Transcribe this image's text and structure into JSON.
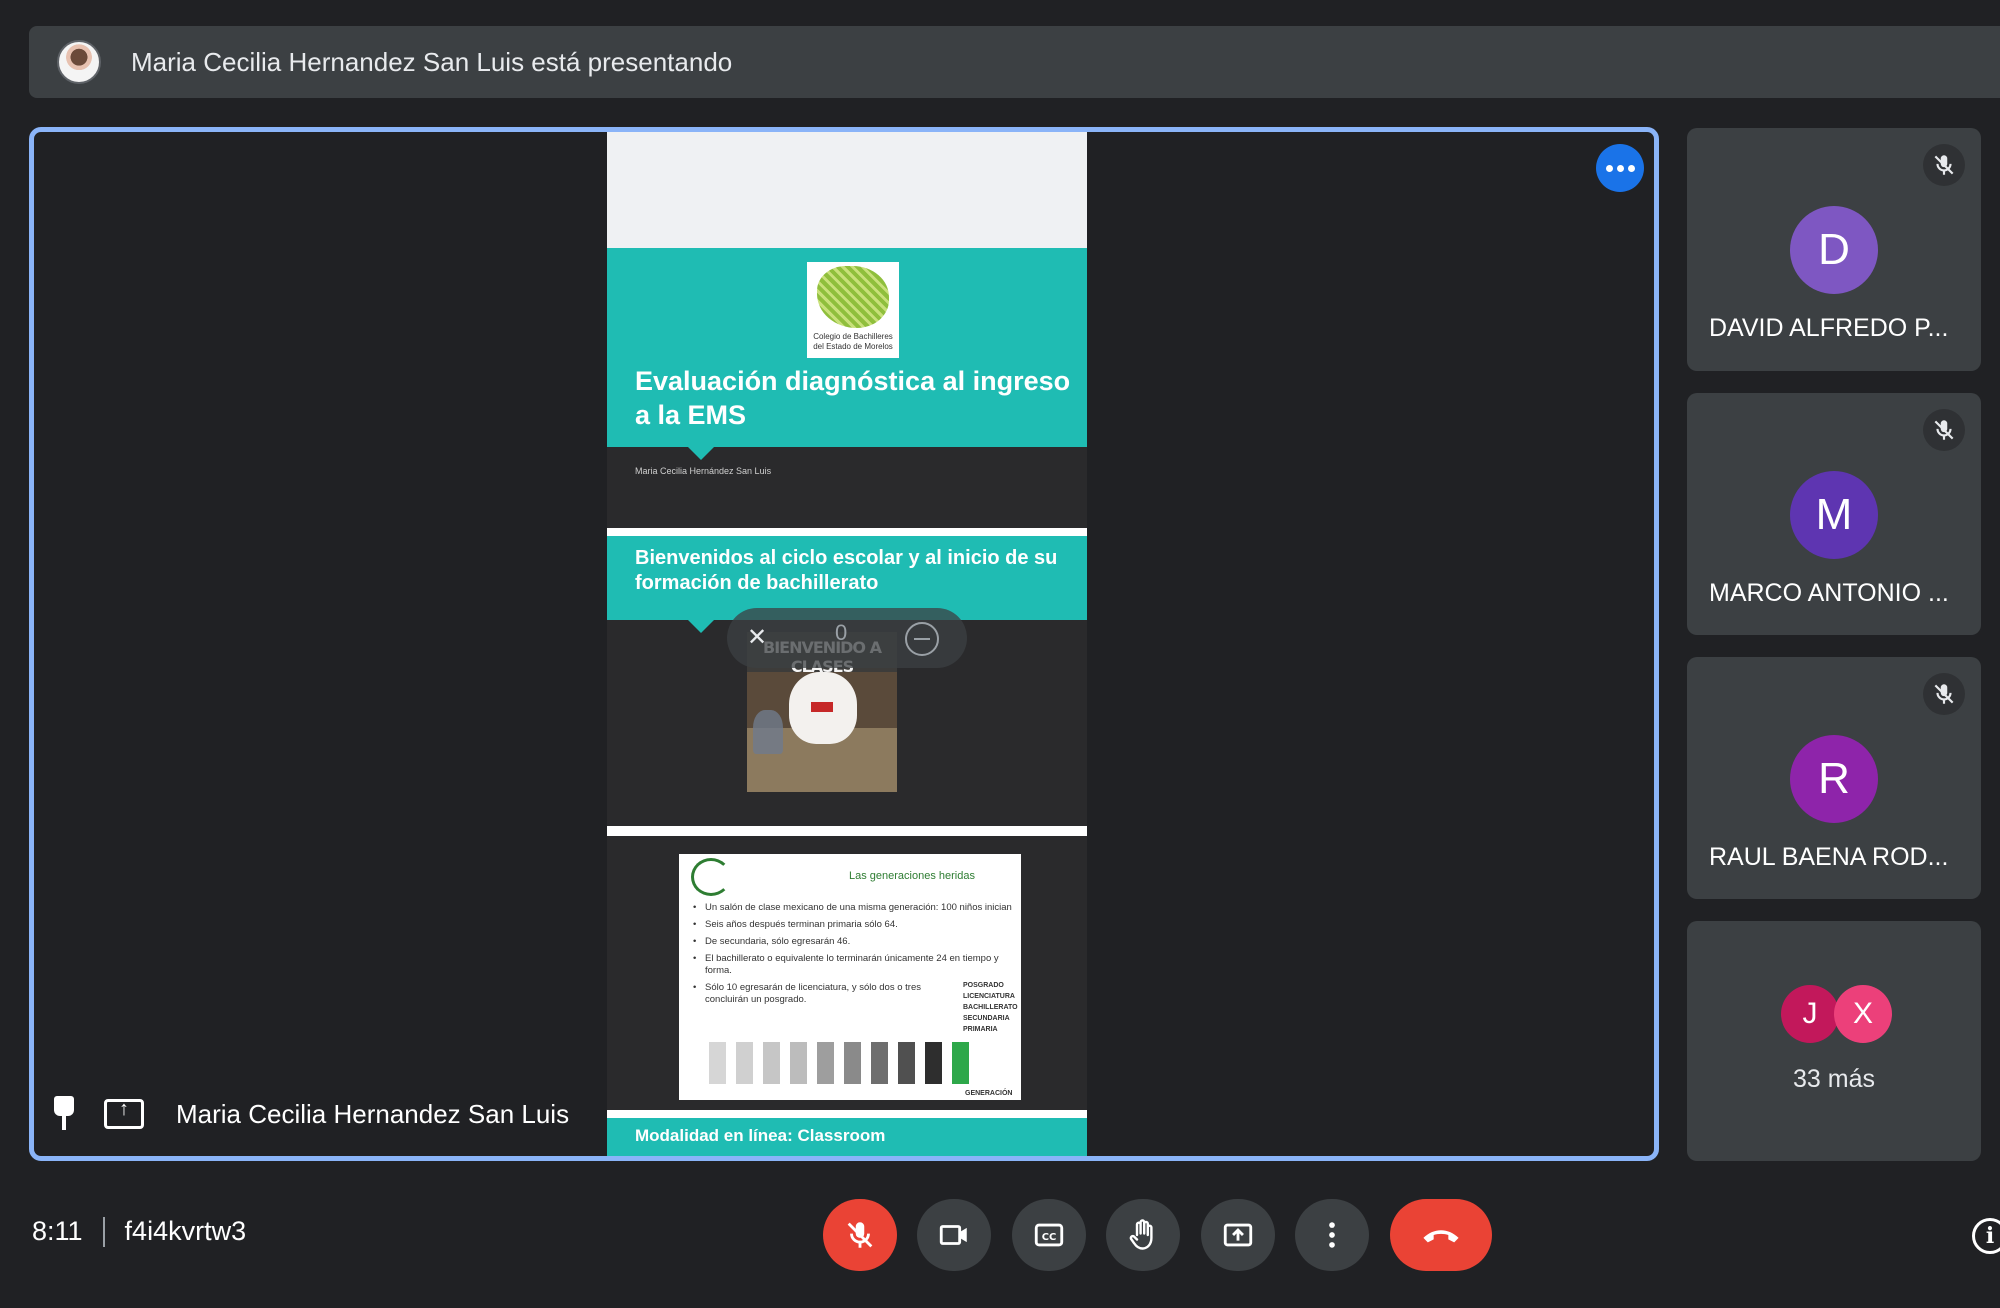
{
  "banner": {
    "text": "Maria Cecilia Hernandez San Luis está presentando"
  },
  "slides": {
    "slide1": {
      "logo_caption": "Colegio de Bachilleres del Estado de Morelos",
      "title": "Evaluación diagnóstica al ingreso a la EMS",
      "author": "Maria Cecilia Hernández San Luis"
    },
    "slide2": {
      "title": "Bienvenidos al ciclo escolar y al inicio de su formación de bachillerato",
      "image_caption": "BIENVENIDO A CLASES",
      "overlay_counter": "0"
    },
    "slide3": {
      "header": "Las generaciones heridas",
      "bullets": [
        "Un salón de clase mexicano de una misma generación: 100 niños inician",
        "Seis años después terminan primaria sólo 64.",
        "De secundaria, sólo egresarán 46.",
        "El bachillerato o equivalente lo terminarán únicamente 24 en tiempo y forma.",
        "Sólo 10 egresarán de licenciatura, y sólo dos o tres concluirán un posgrado."
      ],
      "levels": [
        "POSGRADO",
        "LICENCIATURA",
        "BACHILLERATO",
        "SECUNDARIA",
        "PRIMARIA"
      ],
      "axis_label": "GENERACIÓN"
    },
    "slide4": {
      "title": "Modalidad en línea: Classroom"
    }
  },
  "stage": {
    "presenter_name": "Maria Cecilia Hernandez San Luis"
  },
  "participants": [
    {
      "initial": "D",
      "name": "DAVID ALFREDO P...",
      "color": "#7e57c2"
    },
    {
      "initial": "M",
      "name": "MARCO ANTONIO ...",
      "color": "#5e35b1"
    },
    {
      "initial": "R",
      "name": "RAUL BAENA ROD...",
      "color": "#8e24aa"
    }
  ],
  "others": {
    "avatars": [
      {
        "initial": "J",
        "color": "#c2185b"
      },
      {
        "initial": "X",
        "color": "#ec407a"
      }
    ],
    "label": "33 más"
  },
  "bottom": {
    "time": "8:11",
    "meeting_code": "f4i4kvrtw3"
  },
  "colors": {
    "accent": "#8ab4f8",
    "teal": "#1fbcb3",
    "danger": "#ea4335",
    "more_button": "#1a73e8"
  }
}
